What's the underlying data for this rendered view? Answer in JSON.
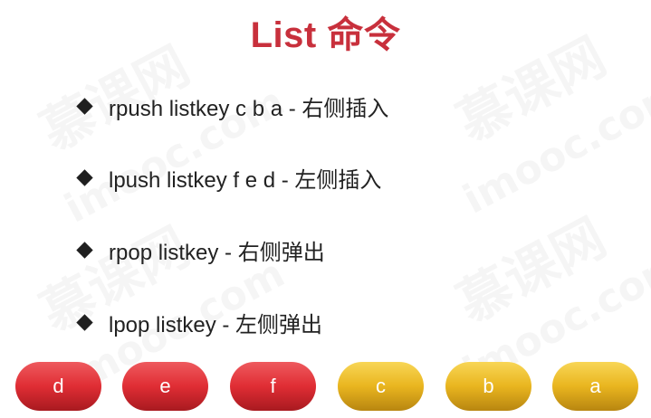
{
  "slide": {
    "title": "List 命令"
  },
  "bullets": [
    {
      "text": "rpush listkey c b a  - 右侧插入"
    },
    {
      "text": "lpush listkey f e d - 左侧插入"
    },
    {
      "text": "rpop listkey - 右侧弹出"
    },
    {
      "text": "lpop listkey - 左侧弹出"
    }
  ],
  "pills": [
    {
      "label": "d",
      "color": "#e02d34"
    },
    {
      "label": "e",
      "color": "#e02d34"
    },
    {
      "label": "f",
      "color": "#e02d34"
    },
    {
      "label": "c",
      "color": "#e9b51f"
    },
    {
      "label": "b",
      "color": "#e9b51f"
    },
    {
      "label": "a",
      "color": "#e9b51f"
    }
  ],
  "watermark": {
    "brand_cn": "慕课网",
    "brand_en": "imooc.com"
  }
}
